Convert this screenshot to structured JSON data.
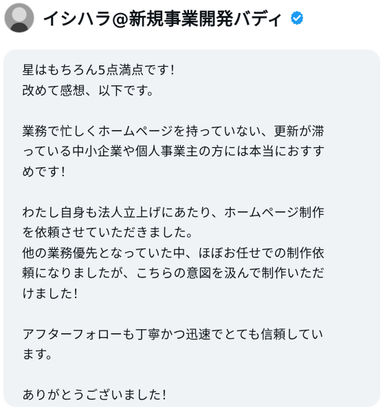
{
  "user": {
    "name": "イシハラ@新規事業開発バディ",
    "avatar_icon": "person-avatar-icon",
    "verified_icon": "verified-badge-icon",
    "verified_color": "#1d9bf0"
  },
  "message": {
    "text": "星はもちろん5点満点です！\n改めて感想、以下です。\n\n業務で忙しくホームページを持っていない、更新が滞\nっている中小企業や個人事業主の方には本当におすす\nめです！\n\nわたし自身も法人立上げにあたり、ホームページ制作\nを依頼させていただきました。\n他の業務優先となっていた中、ほぼお任せでの制作依\n頼になりましたが、こちらの意図を汲んで制作いただ\nけました！\n\nアフターフォローも丁寧かつ迅速でとても信頼してい\nます。\n\nありがとうございました！"
  },
  "colors": {
    "bubble_background": "#eff3f6",
    "text": "#0f1419"
  }
}
